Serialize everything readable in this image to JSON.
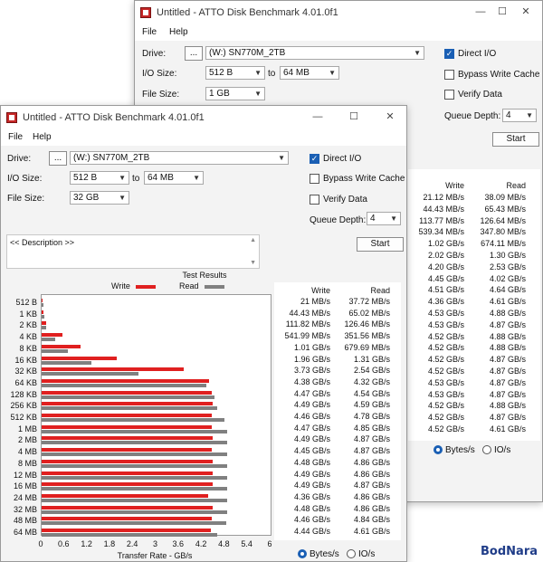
{
  "app_title": "Untitled - ATTO Disk Benchmark 4.01.0f1",
  "menu": {
    "file": "File",
    "help": "Help"
  },
  "labels": {
    "drive": "Drive:",
    "io_size": "I/O Size:",
    "to": "to",
    "file_size": "File Size:",
    "direct_io": "Direct I/O",
    "bypass": "Bypass Write Cache",
    "verify": "Verify Data",
    "queue_depth": "Queue Depth:",
    "start": "Start",
    "browse": "...",
    "description": "<< Description >>",
    "test_results": "Test Results",
    "write": "Write",
    "read": "Read",
    "x_axis": "Transfer Rate - GB/s",
    "bytes_s": "Bytes/s",
    "io_s": "IO/s"
  },
  "back_window": {
    "drive": "(W:) SN770M_2TB",
    "io_from": "512 B",
    "io_to": "64 MB",
    "file_size": "1 GB",
    "queue_depth": "4",
    "direct_io": true,
    "bypass": false,
    "verify": false,
    "units": "bytes",
    "write": [
      "21.12 MB/s",
      "44.43 MB/s",
      "113.77 MB/s",
      "539.34 MB/s",
      "1.02 GB/s",
      "2.02 GB/s",
      "4.20 GB/s",
      "4.45 GB/s",
      "4.51 GB/s",
      "4.36 GB/s",
      "4.53 GB/s",
      "4.53 GB/s",
      "4.52 GB/s",
      "4.52 GB/s",
      "4.52 GB/s",
      "4.52 GB/s",
      "4.53 GB/s",
      "4.53 GB/s",
      "4.52 GB/s",
      "4.52 GB/s",
      "4.52 GB/s"
    ],
    "read": [
      "38.09 MB/s",
      "65.43 MB/s",
      "126.64 MB/s",
      "347.80 MB/s",
      "674.11 MB/s",
      "1.30 GB/s",
      "2.53 GB/s",
      "4.02 GB/s",
      "4.64 GB/s",
      "4.61 GB/s",
      "4.88 GB/s",
      "4.87 GB/s",
      "4.88 GB/s",
      "4.88 GB/s",
      "4.87 GB/s",
      "4.87 GB/s",
      "4.87 GB/s",
      "4.87 GB/s",
      "4.88 GB/s",
      "4.87 GB/s",
      "4.61 GB/s"
    ]
  },
  "front_window": {
    "drive": "(W:) SN770M_2TB",
    "io_from": "512 B",
    "io_to": "64 MB",
    "file_size": "32 GB",
    "queue_depth": "4",
    "direct_io": true,
    "bypass": false,
    "verify": false,
    "units": "bytes"
  },
  "chart_data": {
    "type": "bar",
    "title": "Test Results",
    "xlabel": "Transfer Rate - GB/s",
    "xlim": [
      0,
      6
    ],
    "xticks": [
      "0",
      "0.6",
      "1.2",
      "1.8",
      "2.4",
      "3",
      "3.6",
      "4.2",
      "4.8",
      "5.4",
      "6"
    ],
    "legend": "top",
    "colors": {
      "write": "#e02020",
      "read": "#808080"
    },
    "categories": [
      "512 B",
      "1 KB",
      "2 KB",
      "4 KB",
      "8 KB",
      "16 KB",
      "32 KB",
      "64 KB",
      "128 KB",
      "256 KB",
      "512 KB",
      "1 MB",
      "2 MB",
      "4 MB",
      "8 MB",
      "12 MB",
      "16 MB",
      "24 MB",
      "32 MB",
      "48 MB",
      "64 MB"
    ],
    "series": [
      {
        "name": "Write",
        "values": [
          0.021,
          0.044,
          0.112,
          0.542,
          1.01,
          1.96,
          3.73,
          4.38,
          4.47,
          4.49,
          4.46,
          4.47,
          4.49,
          4.45,
          4.48,
          4.49,
          4.49,
          4.36,
          4.48,
          4.46,
          4.44
        ],
        "labels": [
          "21 MB/s",
          "44.43 MB/s",
          "111.82 MB/s",
          "541.99 MB/s",
          "1.01 GB/s",
          "1.96 GB/s",
          "3.73 GB/s",
          "4.38 GB/s",
          "4.47 GB/s",
          "4.49 GB/s",
          "4.46 GB/s",
          "4.47 GB/s",
          "4.49 GB/s",
          "4.45 GB/s",
          "4.48 GB/s",
          "4.49 GB/s",
          "4.49 GB/s",
          "4.36 GB/s",
          "4.48 GB/s",
          "4.46 GB/s",
          "4.44 GB/s"
        ]
      },
      {
        "name": "Read",
        "values": [
          0.038,
          0.065,
          0.126,
          0.352,
          0.68,
          1.31,
          2.54,
          4.32,
          4.54,
          4.59,
          4.78,
          4.85,
          4.87,
          4.87,
          4.86,
          4.86,
          4.87,
          4.86,
          4.86,
          4.84,
          4.61
        ],
        "labels": [
          "37.72 MB/s",
          "65.02 MB/s",
          "126.46 MB/s",
          "351.56 MB/s",
          "679.69 MB/s",
          "1.31 GB/s",
          "2.54 GB/s",
          "4.32 GB/s",
          "4.54 GB/s",
          "4.59 GB/s",
          "4.78 GB/s",
          "4.85 GB/s",
          "4.87 GB/s",
          "4.87 GB/s",
          "4.86 GB/s",
          "4.86 GB/s",
          "4.87 GB/s",
          "4.86 GB/s",
          "4.86 GB/s",
          "4.84 GB/s",
          "4.61 GB/s"
        ]
      }
    ]
  },
  "watermark": "BodNara"
}
